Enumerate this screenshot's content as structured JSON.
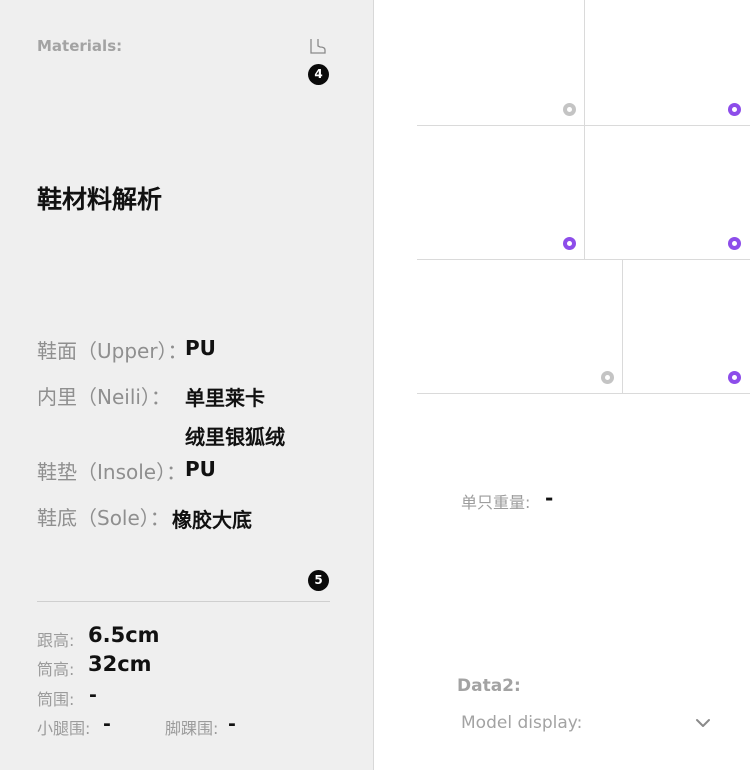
{
  "materials_panel": {
    "header_label": "Materials:",
    "badge_top": "4",
    "title": "鞋材料解析",
    "items": [
      {
        "label": "鞋面（Upper）：",
        "values": [
          "PU"
        ]
      },
      {
        "label": "内里（Neili）：",
        "values": [
          "单里莱卡",
          "绒里银狐绒"
        ]
      },
      {
        "label": "鞋垫（Insole）：",
        "values": [
          "PU"
        ]
      },
      {
        "label": "鞋底（Sole）：",
        "values": [
          "橡胶大底"
        ]
      }
    ],
    "badge_bottom": "5",
    "specs": {
      "heel_height": {
        "label": "跟高:",
        "value": "6.5cm"
      },
      "shaft_height": {
        "label": "筒高:",
        "value": "32cm"
      },
      "shaft_circumference": {
        "label": "筒围:",
        "value": "-"
      },
      "calf_circumference": {
        "label": "小腿围:",
        "value": "-"
      },
      "ankle_circumference": {
        "label": "脚踝围:",
        "value": "-"
      }
    }
  },
  "right_panel": {
    "weight": {
      "label": "单只重量:",
      "value": "-"
    },
    "data2_label": "Data2:",
    "model_display": {
      "label": "Model display:",
      "icon": "chevron-down-icon"
    },
    "dot_colors": {
      "inactive": "#c4c4c4",
      "active": "#8d4dea"
    },
    "dots": [
      "inactive",
      "active",
      "active",
      "active",
      "inactive",
      "active"
    ]
  }
}
